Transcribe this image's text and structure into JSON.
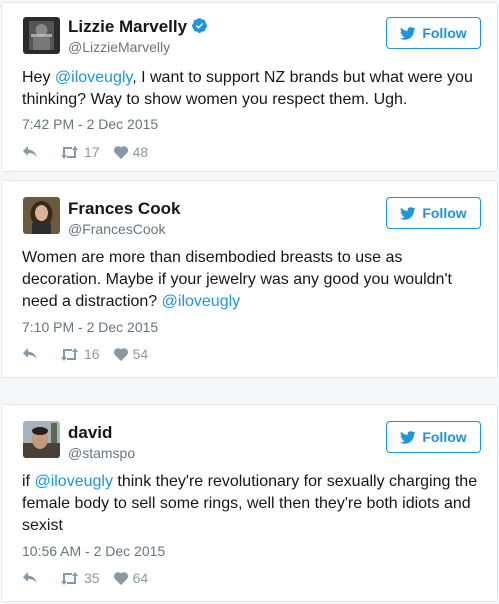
{
  "tweets": [
    {
      "display_name": "Lizzie Marvelly",
      "handle": "@LizzieMarvelly",
      "verified": true,
      "text_before": "Hey ",
      "mention": "@iloveugly",
      "text_after": ", I want to support NZ brands but what were you thinking? Way to show women you respect them. Ugh.",
      "timestamp": "7:42 PM - 2 Dec 2015",
      "retweets": "17",
      "likes": "48",
      "follow_label": "Follow"
    },
    {
      "display_name": "Frances Cook",
      "handle": "@FrancesCook",
      "verified": false,
      "text_before": "Women are more than disembodied breasts to use as decoration. Maybe if your jewelry was any good you wouldn't need a distraction? ",
      "mention": "@iloveugly",
      "text_after": "",
      "timestamp": "7:10 PM - 2 Dec 2015",
      "retweets": "16",
      "likes": "54",
      "follow_label": "Follow"
    },
    {
      "display_name": "david",
      "handle": "@stamspo",
      "verified": false,
      "text_before": "if ",
      "mention": "@iloveugly",
      "text_after": " think they're revolutionary for sexually charging the female body to sell some rings, well then they're both idiots and sexist",
      "timestamp": "10:56 AM - 2 Dec 2015",
      "retweets": "35",
      "likes": "64",
      "follow_label": "Follow"
    }
  ],
  "colors": {
    "accent": "#1b95e0",
    "muted": "#66757f",
    "icon": "#8899a6",
    "border": "#e1e8ed"
  },
  "icons": {
    "follow": "bird-icon",
    "verified": "verified-badge-icon",
    "reply": "reply-icon",
    "retweet": "retweet-icon",
    "like": "heart-icon"
  }
}
